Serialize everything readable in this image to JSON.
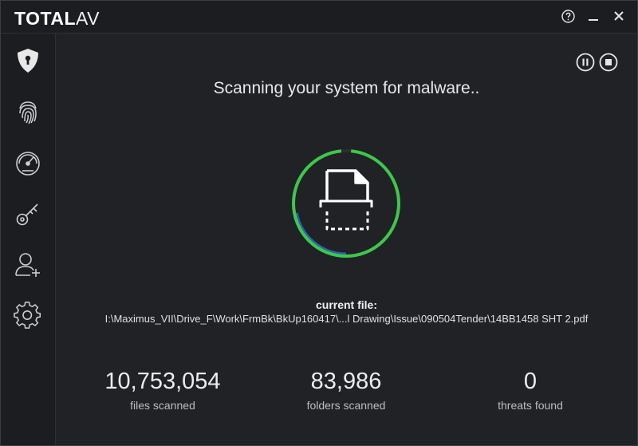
{
  "app": {
    "logo_bold": "TOTAL",
    "logo_light": "AV"
  },
  "window_controls": {
    "help_icon": "question-circle-icon",
    "minimize_icon": "minimize-icon",
    "close_icon": "close-icon"
  },
  "sidebar": {
    "items": [
      {
        "icon": "shield-icon",
        "active": true
      },
      {
        "icon": "fingerprint-icon",
        "active": false
      },
      {
        "icon": "speedometer-icon",
        "active": false
      },
      {
        "icon": "key-icon",
        "active": false
      },
      {
        "icon": "add-user-icon",
        "active": false
      },
      {
        "icon": "gear-icon",
        "active": false
      }
    ]
  },
  "scan": {
    "heading": "Scanning your system for malware..",
    "progress": 0.97,
    "current_file_label": "current file:",
    "current_file_path": "I:\\Maximus_VII\\Drive_F\\Work\\FrmBk\\BkUp160417\\...l Drawing\\Issue\\090504Tender\\14BB1458  SHT 2.pdf",
    "pause_icon": "pause-icon",
    "stop_icon": "stop-icon"
  },
  "stats": [
    {
      "value": "10,753,054",
      "label": "files scanned"
    },
    {
      "value": "83,986",
      "label": "folders scanned"
    },
    {
      "value": "0",
      "label": "threats found"
    }
  ],
  "colors": {
    "ring_green": "#3cc94a",
    "ring_blue": "#2f5fb0",
    "background": "#202226",
    "sidebar": "#1b1d20"
  }
}
